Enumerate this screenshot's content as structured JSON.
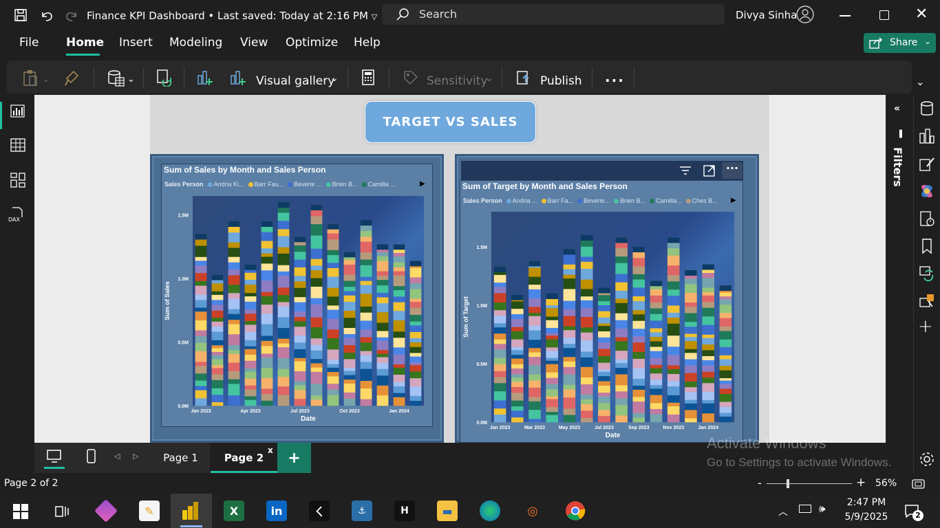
{
  "window": {
    "title": "Finance KPI Dashboard",
    "saved": "Last saved: Today at 2:16 PM",
    "search_placeholder": "Search",
    "user": "Divya Sinha"
  },
  "menu": [
    "File",
    "Home",
    "Insert",
    "Modeling",
    "View",
    "Optimize",
    "Help"
  ],
  "share_label": "Share",
  "ribbon": {
    "visual_gallery": "Visual gallery",
    "sensitivity": "Sensitivity",
    "publish": "Publish",
    "more": "..."
  },
  "filters_label": "Filters",
  "report": {
    "title": "TARGET VS SALES"
  },
  "chart_data": [
    {
      "type": "bar",
      "title": "Sum of Sales by Month and Sales Person",
      "legend_title": "Sales Person",
      "xlabel": "Date",
      "ylabel": "Sum of Sales",
      "yticks": [
        "0.0M",
        "0.5M",
        "1.0M",
        "1.5M"
      ],
      "xticks": [
        "Jan 2023",
        "Apr 2023",
        "Jul 2023",
        "Oct 2023",
        "Jan 2024"
      ],
      "ylim": [
        0,
        1.65
      ],
      "series": [
        {
          "name": "Andria Ki...",
          "color": "#6fa8dc"
        },
        {
          "name": "Barr Fau...",
          "color": "#f1c232"
        },
        {
          "name": "Beverie ...",
          "color": "#3d6fd0"
        },
        {
          "name": "Brien B...",
          "color": "#45c4a0"
        },
        {
          "name": "Camilla ...",
          "color": "#1f7a5a"
        }
      ],
      "values": [
        1.35,
        1.03,
        1.45,
        1.11,
        1.45,
        1.6,
        1.33,
        1.58,
        1.43,
        1.21,
        1.46,
        1.27,
        1.27,
        1.14
      ]
    },
    {
      "type": "bar",
      "title": "Sum of Target by Month and Sales Person",
      "legend_title": "Sales Person",
      "xlabel": "Date",
      "ylabel": "Sum of Target",
      "yticks": [
        "0.0M",
        "0.5M",
        "1.0M",
        "1.5M"
      ],
      "xticks": [
        "Jan 2023",
        "Mar 2023",
        "May 2023",
        "Jul 2023",
        "Sep 2023",
        "Nov 2023",
        "Jan 2024"
      ],
      "ylim": [
        0,
        1.8
      ],
      "series": [
        {
          "name": "Andria ...",
          "color": "#6fa8dc"
        },
        {
          "name": "Barr Fa...",
          "color": "#f1c232"
        },
        {
          "name": "Beverie...",
          "color": "#3d6fd0"
        },
        {
          "name": "Brien B...",
          "color": "#45c4a0"
        },
        {
          "name": "Camilla...",
          "color": "#1f7a5a"
        },
        {
          "name": "Ches B...",
          "color": "#b59b7c"
        }
      ],
      "values": [
        1.33,
        1.09,
        1.38,
        1.1,
        1.48,
        1.6,
        1.15,
        1.58,
        1.5,
        1.21,
        1.58,
        1.3,
        1.35,
        1.17
      ]
    }
  ],
  "pages": {
    "page1": "Page 1",
    "page2": "Page 2",
    "add": "+"
  },
  "status": {
    "page_of": "Page 2 of 2",
    "zoom": "56%"
  },
  "watermark": {
    "line1": "Activate Windows",
    "line2": "Go to Settings to activate Windows."
  },
  "taskbar": {
    "time": "2:47 PM",
    "date": "5/9/2025",
    "notif": "2"
  }
}
